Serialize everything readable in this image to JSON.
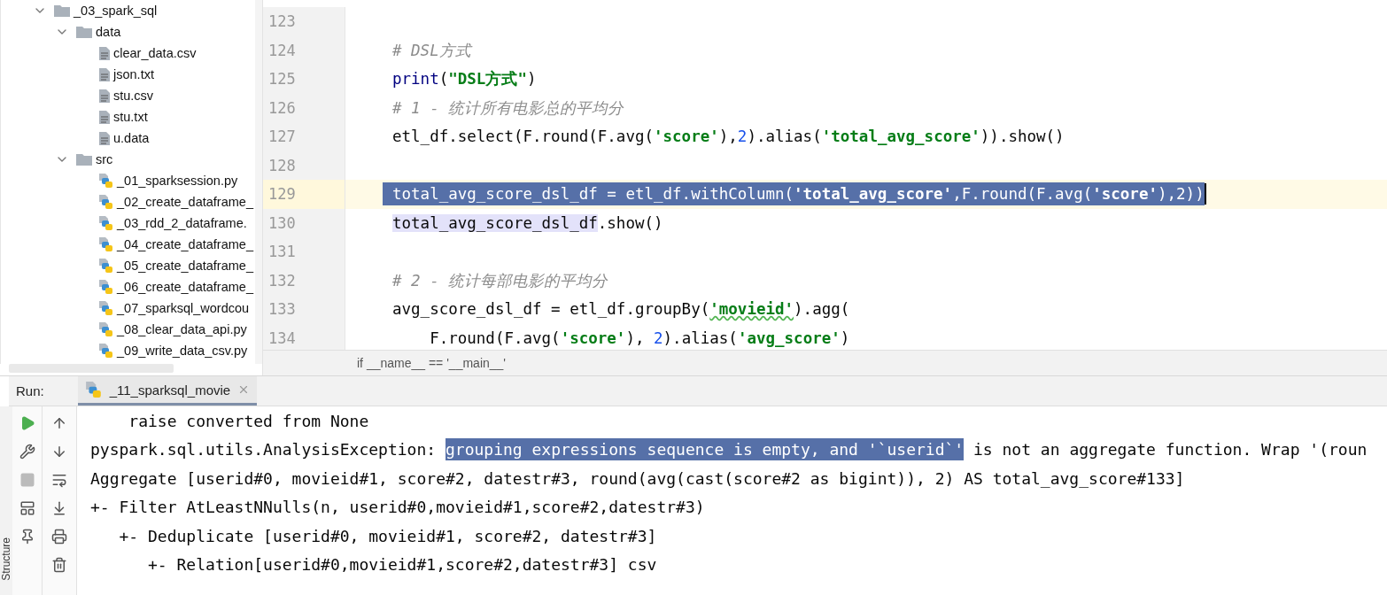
{
  "project_tree": [
    {
      "label": "_03_spark_sql",
      "kind": "folder",
      "expanded": true,
      "children": [
        {
          "label": "data",
          "kind": "folder",
          "expanded": true,
          "children": [
            {
              "label": "clear_data.csv",
              "kind": "text"
            },
            {
              "label": "json.txt",
              "kind": "text"
            },
            {
              "label": "stu.csv",
              "kind": "text"
            },
            {
              "label": "stu.txt",
              "kind": "text"
            },
            {
              "label": "u.data",
              "kind": "text"
            }
          ]
        },
        {
          "label": "src",
          "kind": "folder",
          "expanded": true,
          "children": [
            {
              "label": "_01_sparksession.py",
              "kind": "python"
            },
            {
              "label": "_02_create_dataframe_",
              "kind": "python"
            },
            {
              "label": "_03_rdd_2_dataframe.",
              "kind": "python"
            },
            {
              "label": "_04_create_dataframe_",
              "kind": "python"
            },
            {
              "label": "_05_create_dataframe_",
              "kind": "python"
            },
            {
              "label": "_06_create_dataframe_",
              "kind": "python"
            },
            {
              "label": "_07_sparksql_wordcou",
              "kind": "python"
            },
            {
              "label": "_08_clear_data_api.py",
              "kind": "python"
            },
            {
              "label": "_09_write_data_csv.py",
              "kind": "python"
            }
          ]
        }
      ]
    }
  ],
  "editor": {
    "lines": [
      {
        "number": "123",
        "current": false,
        "selected": false
      },
      {
        "number": "124",
        "current": false,
        "selected": false,
        "tokens": [
          {
            "text": "# DSL方式",
            "kind": "comment"
          }
        ]
      },
      {
        "number": "125",
        "current": false,
        "selected": false,
        "tokens": [
          {
            "text": "print",
            "kind": "builtin"
          },
          {
            "text": "(",
            "kind": "plain"
          },
          {
            "text": "\"DSL方式\"",
            "kind": "string"
          },
          {
            "text": ")",
            "kind": "plain"
          }
        ]
      },
      {
        "number": "126",
        "current": false,
        "selected": false,
        "tokens": [
          {
            "text": "# 1 - 统计所有电影总的平均分",
            "kind": "comment"
          }
        ]
      },
      {
        "number": "127",
        "current": false,
        "selected": false,
        "tokens": [
          {
            "text": "etl_df.select(F.round(F.avg(",
            "kind": "plain"
          },
          {
            "text": "'score'",
            "kind": "string"
          },
          {
            "text": "),",
            "kind": "plain"
          },
          {
            "text": "2",
            "kind": "number"
          },
          {
            "text": ").alias(",
            "kind": "plain"
          },
          {
            "text": "'total_avg_score'",
            "kind": "string"
          },
          {
            "text": ")).show()",
            "kind": "plain"
          }
        ]
      },
      {
        "number": "128",
        "current": false,
        "selected": false
      },
      {
        "number": "129",
        "current": true,
        "selected": true,
        "tokens": [
          {
            "text": "total_avg_score_dsl_df = etl_df.withColumn(",
            "kind": "plain"
          },
          {
            "text": "'total_avg_score'",
            "kind": "string"
          },
          {
            "text": ",F.round(F.avg(",
            "kind": "plain"
          },
          {
            "text": "'score'",
            "kind": "string"
          },
          {
            "text": "),2))",
            "kind": "plain"
          }
        ]
      },
      {
        "number": "130",
        "current": false,
        "selected": false,
        "tokens": [
          {
            "text": "total_avg_score_dsl_df",
            "kind": "ref"
          },
          {
            "text": ".show()",
            "kind": "plain"
          }
        ]
      },
      {
        "number": "131",
        "current": false,
        "selected": false
      },
      {
        "number": "132",
        "current": false,
        "selected": false,
        "tokens": [
          {
            "text": "# 2 - 统计每部电影的平均分",
            "kind": "comment"
          }
        ]
      },
      {
        "number": "133",
        "current": false,
        "selected": false,
        "tokens": [
          {
            "text": "avg_score_dsl_df = etl_df.groupBy(",
            "kind": "plain"
          },
          {
            "text": "'movieid'",
            "kind": "string",
            "flagged": true
          },
          {
            "text": ").agg(",
            "kind": "plain"
          }
        ]
      },
      {
        "number": "134",
        "current": false,
        "selected": false,
        "tokens": [
          {
            "text": "    F.round(F.avg(",
            "kind": "plain"
          },
          {
            "text": "'score'",
            "kind": "string"
          },
          {
            "text": "), ",
            "kind": "plain"
          },
          {
            "text": "2",
            "kind": "number"
          },
          {
            "text": ").alias(",
            "kind": "plain"
          },
          {
            "text": "'avg_score'",
            "kind": "string"
          },
          {
            "text": ")",
            "kind": "plain"
          }
        ]
      }
    ],
    "breadcrumb": "if __name__ == '__main__'"
  },
  "run_panel": {
    "label": "Run:",
    "tabs": [
      {
        "label": "_11_sparksql_movie",
        "selected": true
      }
    ],
    "side_tab": "Structure",
    "console": [
      {
        "segments": [
          {
            "text": "    raise converted from None",
            "highlighted": false
          }
        ]
      },
      {
        "segments": [
          {
            "text": "pyspark.sql.utils.AnalysisException: ",
            "highlighted": false
          },
          {
            "text": "grouping expressions sequence is empty, and '`userid`'",
            "highlighted": true
          },
          {
            "text": " is not an aggregate function. Wrap '(roun",
            "highlighted": false
          }
        ]
      },
      {
        "segments": [
          {
            "text": "Aggregate [userid#0, movieid#1, score#2, datestr#3, round(avg(cast(score#2 as bigint)), 2) AS total_avg_score#133]",
            "highlighted": false
          }
        ]
      },
      {
        "segments": [
          {
            "text": "+- Filter AtLeastNNulls(n, userid#0,movieid#1,score#2,datestr#3)",
            "highlighted": false
          }
        ]
      },
      {
        "segments": [
          {
            "text": "   +- Deduplicate [userid#0, movieid#1, score#2, datestr#3]",
            "highlighted": false
          }
        ]
      },
      {
        "segments": [
          {
            "text": "      +- Relation[userid#0,movieid#1,score#2,datestr#3] csv",
            "highlighted": false
          }
        ]
      }
    ]
  }
}
